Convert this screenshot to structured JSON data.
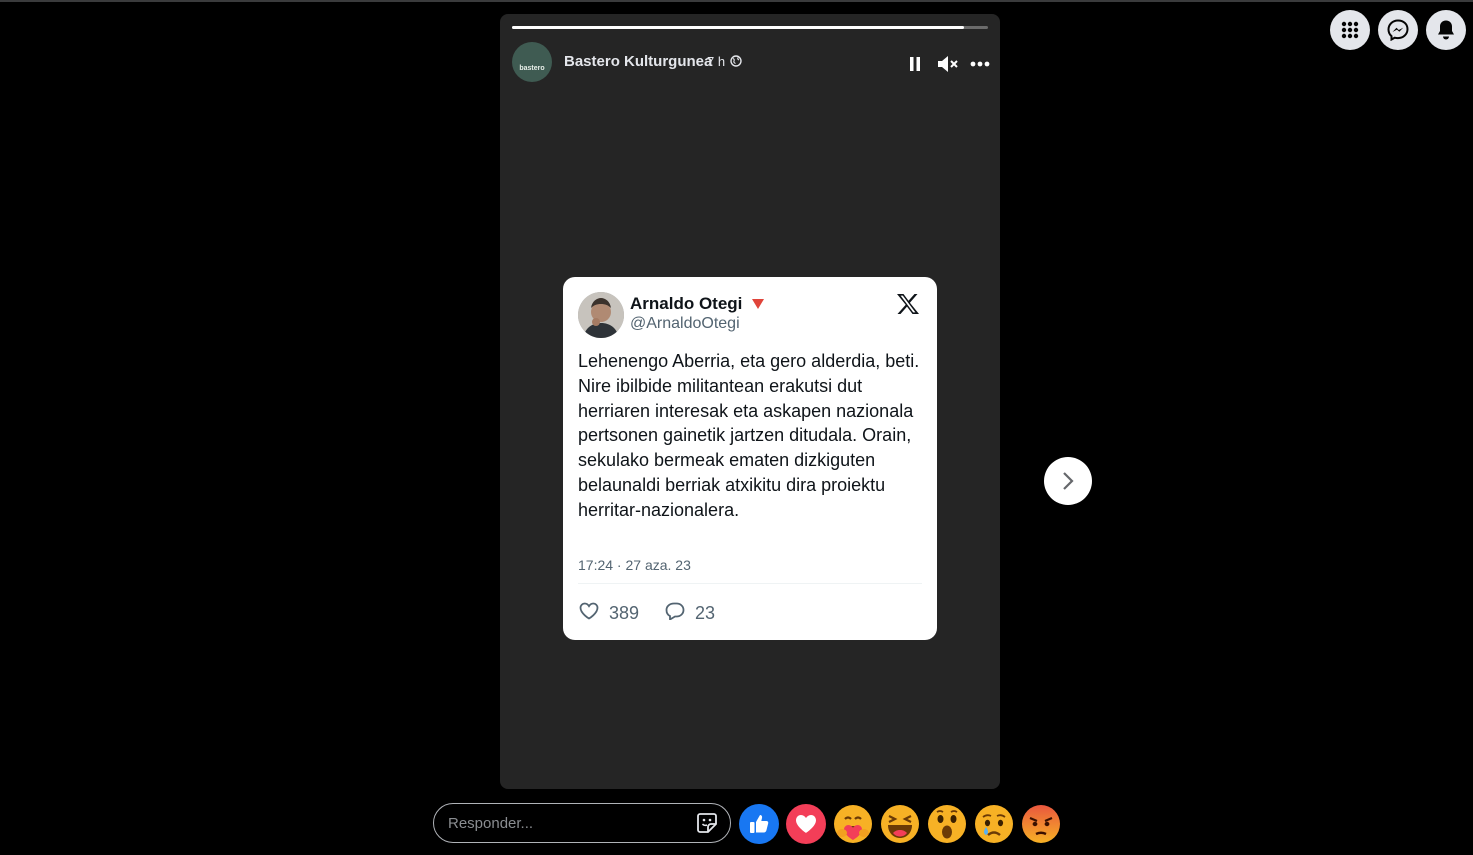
{
  "story": {
    "author": "Bastero Kulturgunea",
    "time": "7 h",
    "avatar_text": "bastero",
    "progress": 0.95
  },
  "tweet": {
    "name": "Arnaldo Otegi",
    "handle": "@ArnaldoOtegi",
    "body": "Lehenengo Aberria, eta gero alderdia, beti. Nire ibilbide militantean erakutsi dut herriaren interesak eta askapen nazionala pertsonen gainetik jartzen ditudala. Orain, sekulako bermeak ematen dizkiguten belaunaldi berriak atxikitu dira proiektu herritar-nazionalera.",
    "date": "17:24 · 27 aza. 23",
    "likes": "389",
    "replies": "23"
  },
  "reply": {
    "placeholder": "Responder..."
  },
  "icons": {
    "top_right": [
      "menu-grid-icon",
      "messenger-icon",
      "bell-icon"
    ],
    "controls": [
      "pause-icon",
      "mute-icon",
      "more-icon"
    ],
    "reactions": [
      "like",
      "love",
      "care",
      "haha",
      "wow",
      "sad",
      "angry"
    ]
  },
  "colors": {
    "like": "#1877f2",
    "love": "#f33e58",
    "emoji": "#f7b125",
    "angry": "#e9573f"
  }
}
